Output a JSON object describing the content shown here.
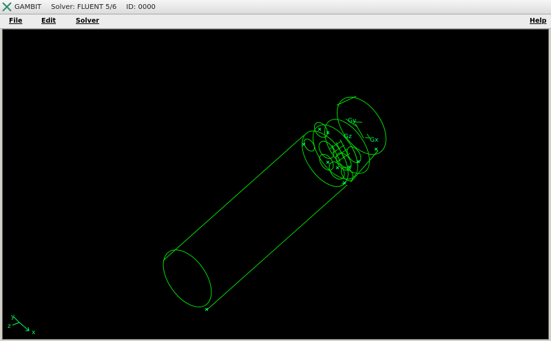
{
  "titlebar": {
    "app_name": "GAMBIT",
    "solver": "Solver: FLUENT 5/6",
    "id": "ID: 0000",
    "icon": "x-cross-icon"
  },
  "menu": {
    "file": "File",
    "edit": "Edit",
    "solver": "Solver",
    "help": "Help"
  },
  "graphics": {
    "line_color": "#00ff00",
    "label_color": "#00ff66",
    "background": "#000000",
    "face_labels": {
      "gy": "Gy",
      "gx": "Gx",
      "gz": "Gz"
    },
    "axis_triad": {
      "y": "y",
      "z": "z",
      "x": "x"
    }
  }
}
